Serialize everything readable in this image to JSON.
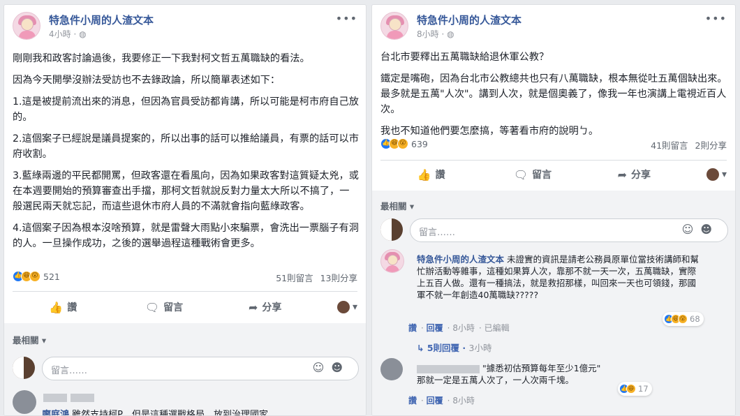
{
  "left_post": {
    "author": "特急件小周的人渣文本",
    "time": "4小時",
    "paragraphs": [
      "剛剛我和政客討論過後，我要修正一下我對柯文哲五萬職缺的看法。",
      "因為今天開學沒辦法受訪也不去錄政論，所以簡單表述如下：",
      "1.這是被提前流出來的消息，但因為官員受訪都肯講，所以可能是柯市府自己放的。",
      "2.這個案子已經說是議員提案的，所以出事的話可以推給議員，有票的話可以市府收割。",
      "3.藍綠兩邊的平民都開罵，但政客還在看風向，因為如果政客對這質疑太兇，或在本週要開始的預算審查出手擋，那柯文哲就說反對力量太大所以不搞了，一般選民兩天就忘記，而這些退休市府人員的不滿就會指向藍綠政客。",
      "4.這個案子因為根本沒啥預算，就是雷聲大雨點小來騙票，會洗出一票腦子有洞的人。一旦操作成功，之後的選舉過程這種戰術會更多。"
    ],
    "reactions_count": "521",
    "comments_count": "51則留言",
    "shares_count": "13則分享",
    "actions": {
      "like": "讚",
      "comment": "留言",
      "share": "分享"
    },
    "sort_label": "最相關 ▾",
    "comment_placeholder": "留言……",
    "first_comment_name": "廖庭鴻",
    "first_comment_text": "雖然支持柯P，但是這種選戰格局，放到治理國家，"
  },
  "right_post": {
    "author": "特急件小周的人渣文本",
    "time": "8小時",
    "paragraphs": [
      "台北市要釋出五萬職缺給退休軍公教？",
      "鐵定是嘴砲，因為台北市公教總共也只有八萬職缺，根本無從吐五萬個缺出來。最多就是五萬\"人次\"。講到人次，就是個奧義了，像我一年也演講上電視近百人次。",
      "我也不知道他們要怎麼搞，等著看市府的說明ㄅ。"
    ],
    "reactions_count": "639",
    "comments_count": "41則留言",
    "shares_count": "2則分享",
    "actions": {
      "like": "讚",
      "comment": "留言",
      "share": "分享"
    },
    "sort_label": "最相關 ▾",
    "comment_placeholder": "留言……",
    "comment1": {
      "name": "特急件小周的人渣文本",
      "text": "未證實的資訊是請老公務員原單位當技術講師和幫忙辦活動等雜事，這種如果算人次，靠那不就一天一次，五萬職缺，實際上五百人做。還有一種搞法，就是救招那樣，叫回來一天也可領錢，那國軍不就一年創造40萬職缺?????",
      "like": "讚",
      "reply": "回覆",
      "time": "8小時",
      "edited": "已編輯",
      "reactions": "68"
    },
    "reply_link": "5則回覆",
    "reply_time": "3小時",
    "comment2": {
      "quote": "\"據悉初估預算每年至少1億元\"",
      "text": "那就一定是五萬人次了，一人次兩千塊。",
      "like": "讚",
      "reply": "回覆",
      "time": "8小時",
      "reactions": "17"
    }
  },
  "colors": {
    "link": "#365899",
    "like_blue": "#2078f4",
    "haha_yellow": "#f7b125"
  }
}
